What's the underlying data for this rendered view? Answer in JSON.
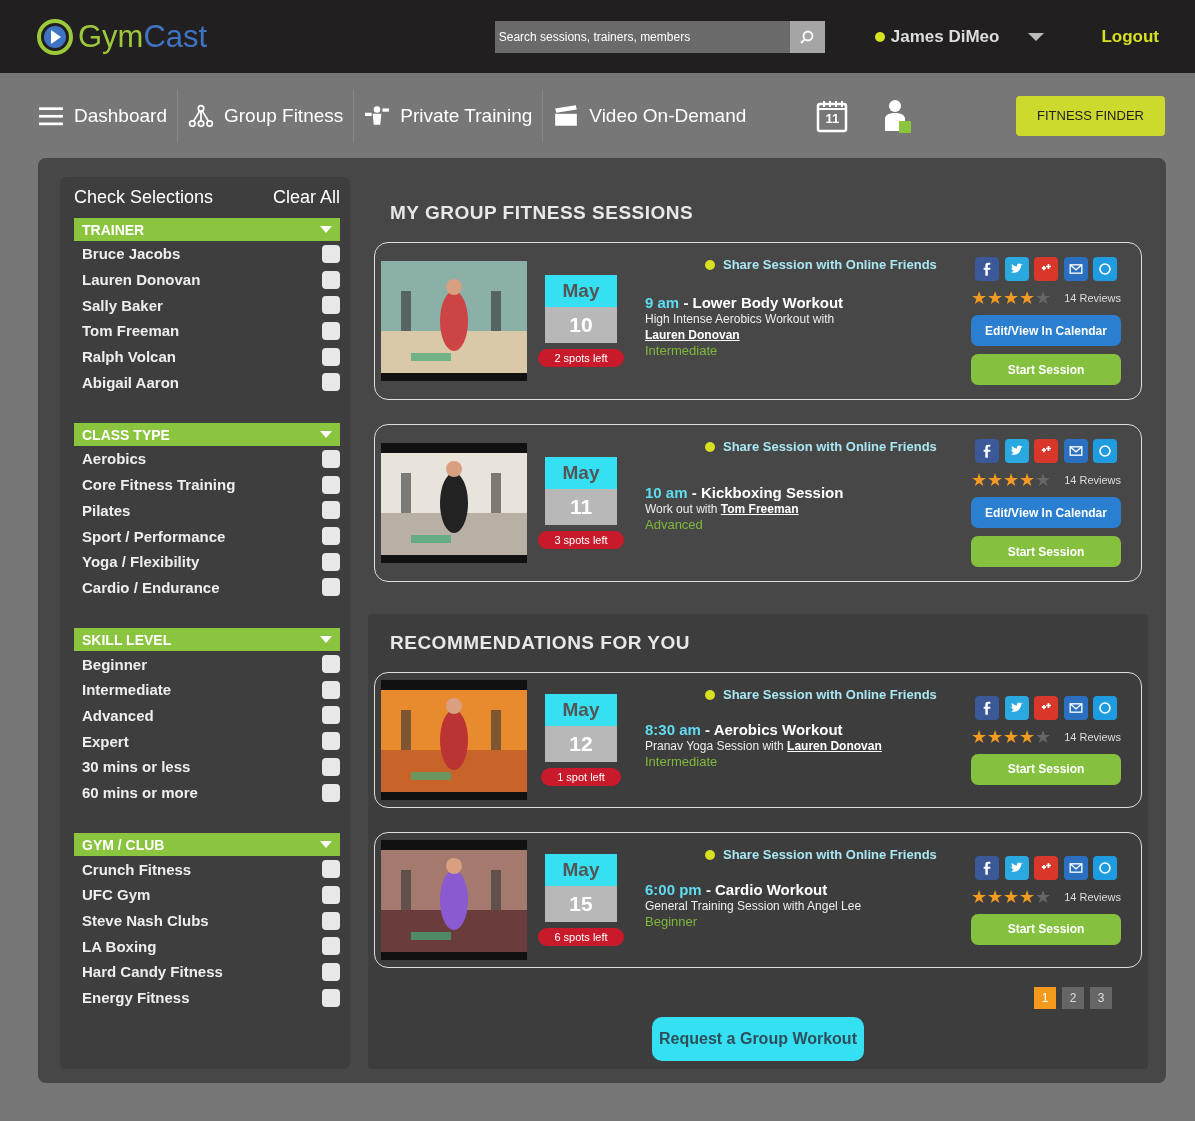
{
  "header": {
    "logo": [
      "Gym",
      "Cast"
    ],
    "search": {
      "placeholder": "Search sessions, trainers, members"
    },
    "user": {
      "name": "James DiMeo"
    },
    "logout": "Logout"
  },
  "nav": {
    "items": [
      {
        "kind": "menu",
        "label": "Dashboard"
      },
      {
        "kind": "group",
        "label": "Group Fitness"
      },
      {
        "kind": "private",
        "label": "Private Training"
      },
      {
        "kind": "video",
        "label": "Video On-Demand"
      }
    ],
    "calendar_day": "11",
    "finder": "FITNESS FINDER"
  },
  "sidebar": {
    "title": "Check Selections",
    "clear": "Clear All",
    "groups": [
      {
        "title": "TRAINER",
        "expanded": true,
        "items": [
          {
            "label": "Bruce Jacobs",
            "checked": false
          },
          {
            "label": "Lauren Donovan",
            "checked": false
          },
          {
            "label": "Sally Baker",
            "checked": false
          },
          {
            "label": "Tom Freeman",
            "checked": false
          },
          {
            "label": "Ralph Volcan",
            "checked": false
          },
          {
            "label": "Abigail Aaron",
            "checked": false
          }
        ]
      },
      {
        "title": "CLASS TYPE",
        "expanded": true,
        "items": [
          {
            "label": "Aerobics",
            "checked": false
          },
          {
            "label": "Core Fitness Training",
            "checked": false
          },
          {
            "label": "Pilates",
            "checked": false
          },
          {
            "label": "Sport / Performance",
            "checked": false
          },
          {
            "label": "Yoga / Flexibility",
            "checked": false
          },
          {
            "label": "Cardio / Endurance",
            "checked": false
          }
        ]
      },
      {
        "title": "SKILL LEVEL",
        "expanded": true,
        "items": [
          {
            "label": "Beginner",
            "checked": false
          },
          {
            "label": "Intermediate",
            "checked": false
          },
          {
            "label": "Advanced",
            "checked": false
          },
          {
            "label": "Expert",
            "checked": false
          },
          {
            "label": "30 mins or less",
            "checked": false
          },
          {
            "label": "60 mins or more",
            "checked": false
          }
        ]
      },
      {
        "title": "GYM / CLUB",
        "expanded": true,
        "items": [
          {
            "label": "Crunch Fitness",
            "checked": false
          },
          {
            "label": "UFC Gym",
            "checked": false
          },
          {
            "label": "Steve Nash Clubs",
            "checked": false
          },
          {
            "label": "LA Boxing",
            "checked": false
          },
          {
            "label": "Hard Candy Fitness",
            "checked": false
          },
          {
            "label": "Energy Fitness",
            "checked": false
          }
        ]
      }
    ]
  },
  "sections": [
    {
      "title": "MY GROUP FITNESS SESSIONS",
      "sessions": [
        {
          "month": "May",
          "day": "10",
          "spots": "2 spots left",
          "share": "Share Session with Online Friends",
          "time": "9 am",
          "title": "- Lower Body Workout",
          "description": "High Intense Aerobics Workout with",
          "trainer": "Lauren Donovan",
          "level": "Intermediate",
          "stars": 4,
          "reviews": "14 Reviews",
          "calendar": "Edit/View In Calendar",
          "start": "Start Session"
        },
        {
          "month": "May",
          "day": "11",
          "spots": "3 spots left",
          "share": "Share Session with Online Friends",
          "time": "10 am",
          "title": "- Kickboxing Session",
          "description": "Work out  with",
          "trainer": "Tom Freeman",
          "level": "Advanced",
          "stars": 4,
          "reviews": "14 Reviews",
          "calendar": "Edit/View In Calendar",
          "start": "Start Session"
        }
      ]
    },
    {
      "title": "RECOMMENDATIONS FOR YOU",
      "sessions": [
        {
          "month": "May",
          "day": "12",
          "spots": "1 spot left",
          "share": "Share Session with Online Friends",
          "time": "8:30 am",
          "title": "- Aerobics Workout",
          "description": "Pranav Yoga Session with",
          "trainer": "Lauren Donovan",
          "level": "Intermediate",
          "stars": 4,
          "reviews": "14 Reviews",
          "start": "Start Session"
        },
        {
          "month": "May",
          "day": "15",
          "spots": "6 spots left",
          "share": "Share Session with Online Friends",
          "time": "6:00 pm",
          "title": "- Cardio Workout",
          "description": "General Training Session with Angel Lee",
          "level": "Beginner",
          "stars": 4,
          "reviews": "14 Reviews",
          "start": "Start Session"
        }
      ]
    }
  ],
  "pagination": [
    {
      "label": "1",
      "selected": true
    },
    {
      "label": "2",
      "selected": false
    },
    {
      "label": "3",
      "selected": false
    }
  ],
  "request": "Request a Group Workout"
}
